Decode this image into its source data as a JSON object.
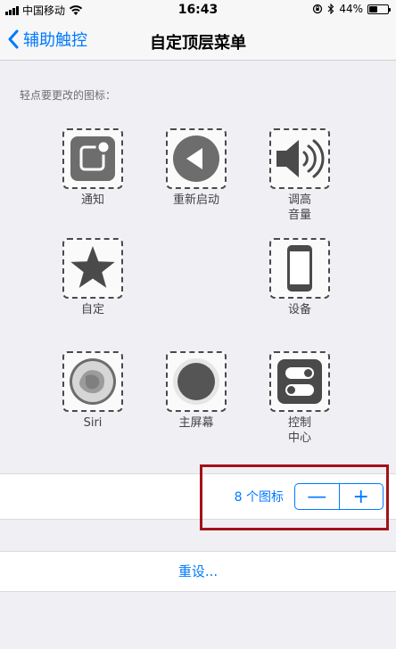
{
  "status_bar": {
    "carrier": "中国移动",
    "time": "16:43",
    "battery": "44%",
    "battery_level": 0.44
  },
  "nav": {
    "back_label": "辅助触控",
    "title": "自定顶层菜单"
  },
  "section_label": "轻点要更改的图标：",
  "icons": {
    "notifications": "通知",
    "restart": "重新启动",
    "volume": "调高\n音量",
    "custom": "自定",
    "device": "设备",
    "siri": "Siri",
    "home": "主屏幕",
    "control_center": "控制\n中心"
  },
  "icon_count": "8 个图标",
  "stepper": {
    "minus": "—",
    "plus": "+"
  },
  "reset_label": "重设...",
  "colors": {
    "accent": "#007aff",
    "highlight": "#a3121a"
  }
}
